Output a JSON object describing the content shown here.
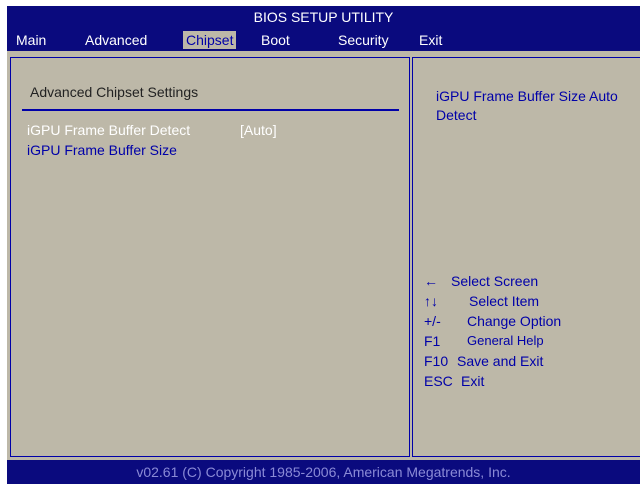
{
  "title": "BIOS SETUP UTILITY",
  "menu": {
    "items": [
      {
        "label": "Main"
      },
      {
        "label": "Advanced"
      },
      {
        "label": "Chipset",
        "selected": true
      },
      {
        "label": "Boot"
      },
      {
        "label": "Security"
      },
      {
        "label": "Exit"
      }
    ]
  },
  "left_panel": {
    "section_title": "Advanced Chipset Settings",
    "settings": [
      {
        "label": "iGPU Frame Buffer Detect",
        "value": "[Auto]",
        "highlighted": true
      },
      {
        "label": "iGPU Frame Buffer Size",
        "value": ""
      }
    ]
  },
  "right_panel": {
    "help_text": "iGPU Frame Buffer Size Auto Detect",
    "keys": [
      {
        "key": "←",
        "desc": "Select Screen"
      },
      {
        "key": "↑↓",
        "desc": "Select Item"
      },
      {
        "key": "+/-",
        "desc": "Change Option"
      },
      {
        "key": "F1",
        "desc": "General Help"
      },
      {
        "key": "F10",
        "desc": "Save and Exit"
      },
      {
        "key": "ESC",
        "desc": "Exit"
      }
    ]
  },
  "footer": "v02.61 (C) Copyright 1985-2006, American Megatrends, Inc.",
  "colors": {
    "header_bg": "#0a0a7e",
    "panel_bg": "#bdb8a8",
    "text_blue": "#0000a8",
    "highlight_text": "#ffffff",
    "footer_text": "#8a8ad6"
  }
}
